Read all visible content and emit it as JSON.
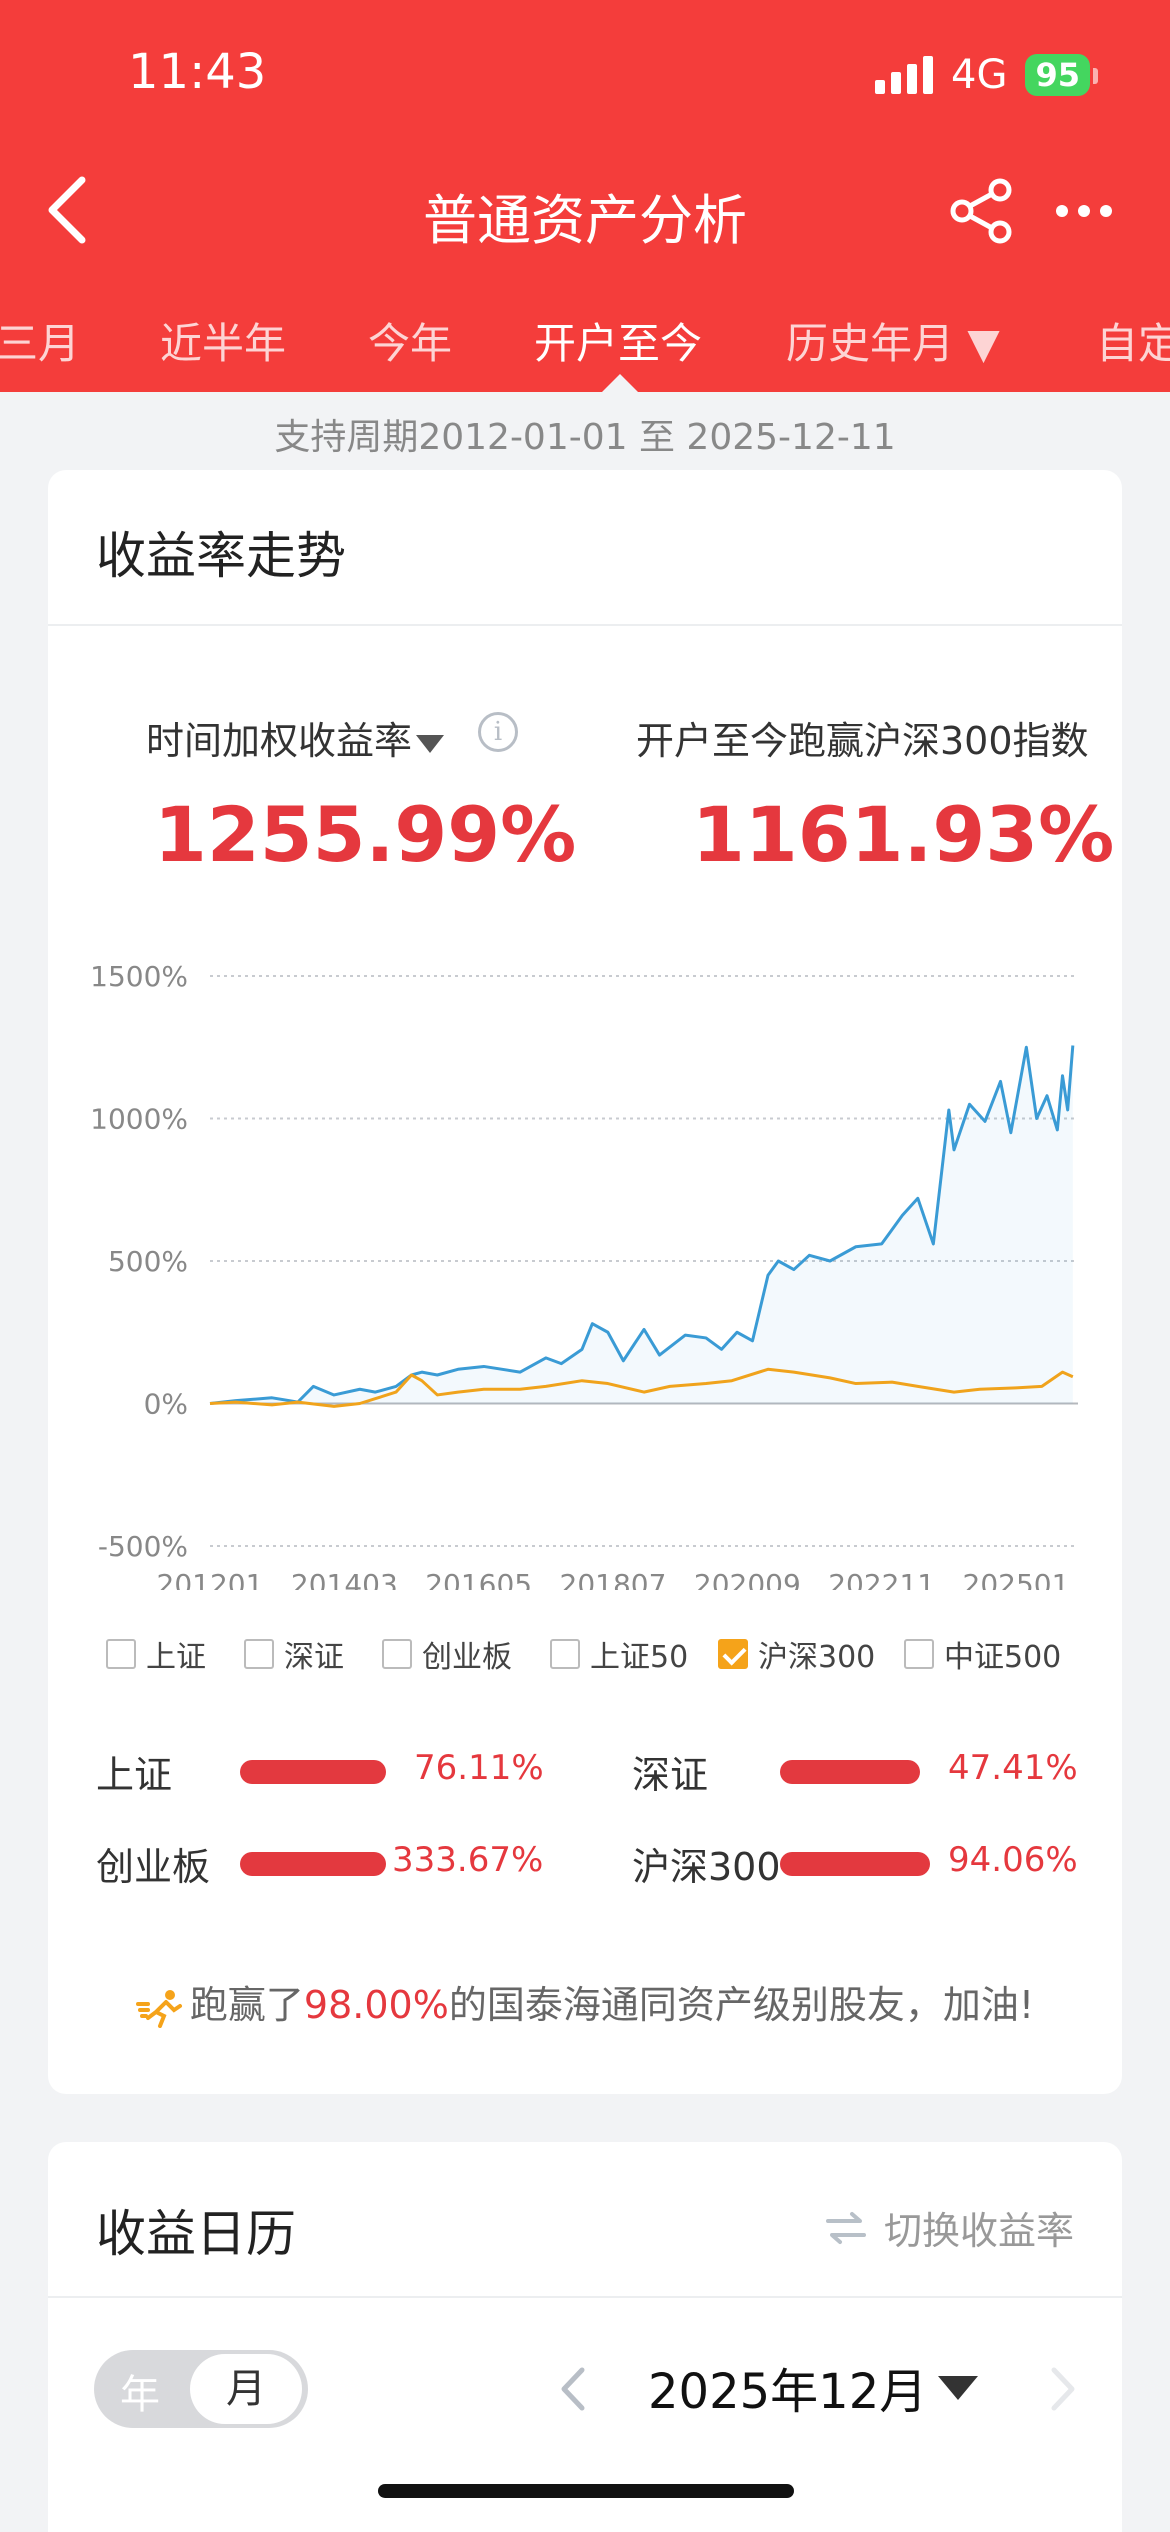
{
  "status_bar": {
    "time": "11:43",
    "network": "4G",
    "battery": "95"
  },
  "header": {
    "title": "普通资产分析"
  },
  "tabs": [
    {
      "label": "三月"
    },
    {
      "label": "近半年"
    },
    {
      "label": "今年"
    },
    {
      "label": "开户至今",
      "active": true
    },
    {
      "label": "历史年月 ▼"
    },
    {
      "label": "自定"
    }
  ],
  "period_note": "支持周期2012-01-01 至 2025-12-11",
  "returns_card": {
    "title": "收益率走势",
    "metric_left": {
      "label": "时间加权收益率",
      "value": "1255.99%"
    },
    "metric_right": {
      "label": "开户至今跑赢沪深300指数",
      "value": "1161.93%"
    },
    "legend": [
      {
        "label": "上证",
        "checked": false
      },
      {
        "label": "深证",
        "checked": false
      },
      {
        "label": "创业板",
        "checked": false
      },
      {
        "label": "上证50",
        "checked": false
      },
      {
        "label": "沪深300",
        "checked": true
      },
      {
        "label": "中证500",
        "checked": false
      }
    ],
    "comparisons": [
      {
        "label": "上证",
        "value": "76.11%"
      },
      {
        "label": "深证",
        "value": "47.41%"
      },
      {
        "label": "创业板",
        "value": "333.67%"
      },
      {
        "label": "沪深300",
        "value": "94.06%"
      }
    ],
    "beat": {
      "prefix": "跑赢了",
      "pct": "98.00%",
      "suffix": "的国泰海通同资产级别股友，加油!"
    }
  },
  "chart_data": {
    "type": "line",
    "y_ticks": [
      "1500%",
      "1000%",
      "500%",
      "0%",
      "-500%"
    ],
    "x_ticks": [
      "201201",
      "201403",
      "201605",
      "201807",
      "202009",
      "202211",
      "202501"
    ],
    "ylim": [
      -500,
      1500
    ],
    "grid": true,
    "colors": {
      "account": "#3a9bd5",
      "hs300": "#f0a31c"
    },
    "series": [
      {
        "key": "account",
        "x": [
          "2012-01",
          "2012-06",
          "2013-01",
          "2013-06",
          "2013-09",
          "2014-01",
          "2014-06",
          "2014-09",
          "2015-01",
          "2015-04",
          "2015-06",
          "2015-09",
          "2016-01",
          "2016-06",
          "2017-01",
          "2017-06",
          "2017-09",
          "2018-01",
          "2018-03",
          "2018-06",
          "2018-09",
          "2019-01",
          "2019-04",
          "2019-09",
          "2020-01",
          "2020-04",
          "2020-07",
          "2020-10",
          "2021-01",
          "2021-03",
          "2021-06",
          "2021-09",
          "2022-01",
          "2022-06",
          "2022-11",
          "2023-03",
          "2023-06",
          "2023-09",
          "2023-12",
          "2024-01",
          "2024-04",
          "2024-07",
          "2024-10",
          "2024-12",
          "2025-03",
          "2025-05",
          "2025-07",
          "2025-09",
          "2025-10",
          "2025-11",
          "2025-12"
        ],
        "values": [
          0,
          10,
          20,
          5,
          60,
          30,
          50,
          40,
          60,
          100,
          110,
          100,
          120,
          130,
          110,
          160,
          140,
          190,
          280,
          250,
          150,
          260,
          170,
          240,
          230,
          190,
          250,
          220,
          450,
          500,
          470,
          520,
          500,
          550,
          560,
          660,
          720,
          560,
          1030,
          890,
          1050,
          990,
          1130,
          950,
          1250,
          1000,
          1080,
          960,
          1150,
          1030,
          1256
        ]
      },
      {
        "key": "hs300",
        "x": [
          "2012-01",
          "2012-06",
          "2013-01",
          "2013-06",
          "2014-01",
          "2014-06",
          "2015-01",
          "2015-04",
          "2015-06",
          "2015-09",
          "2016-01",
          "2016-06",
          "2017-01",
          "2017-06",
          "2018-01",
          "2018-06",
          "2019-01",
          "2019-06",
          "2020-01",
          "2020-06",
          "2021-01",
          "2021-06",
          "2022-01",
          "2022-06",
          "2023-01",
          "2023-06",
          "2024-01",
          "2024-06",
          "2025-01",
          "2025-06",
          "2025-10",
          "2025-12"
        ],
        "values": [
          0,
          5,
          -5,
          5,
          -10,
          0,
          40,
          100,
          80,
          30,
          40,
          50,
          50,
          60,
          80,
          70,
          40,
          60,
          70,
          80,
          120,
          110,
          90,
          70,
          75,
          60,
          40,
          50,
          55,
          60,
          110,
          94
        ]
      }
    ]
  }
}
